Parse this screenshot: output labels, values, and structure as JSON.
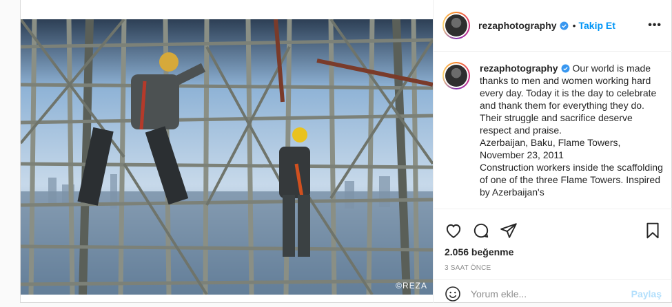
{
  "post": {
    "username": "rezaphotography",
    "follow_label": "Takip Et",
    "more_label": "•••",
    "separator": "•",
    "image_copyright": "©REZA"
  },
  "caption": {
    "username": "rezaphotography",
    "text": "Our world is made thanks to men and women working hard every day. Today it is the day to celebrate and thank them for everything they do. Their struggle and sacrifice deserve respect and praise.\nAzerbaijan, Baku, Flame Towers, November 23, 2011\nConstruction workers inside the scaffolding of one of the three Flame Towers. Inspired by Azerbaijan's"
  },
  "actions": {
    "likes": "2.056 beğenme",
    "time": "3 SAAT ÖNCE"
  },
  "comment": {
    "placeholder": "Yorum ekle...",
    "post_label": "Paylaş"
  },
  "icons": {
    "like": "heart-icon",
    "comment": "comment-bubble-icon",
    "share": "paper-plane-icon",
    "save": "bookmark-icon",
    "emoji": "smiley-icon",
    "verified": "verified-badge-icon",
    "more": "more-options-icon"
  },
  "colors": {
    "accent": "#0095f6",
    "verified": "#3897f0",
    "muted": "#8e8e8e",
    "post_disabled": "#b2dffc"
  }
}
